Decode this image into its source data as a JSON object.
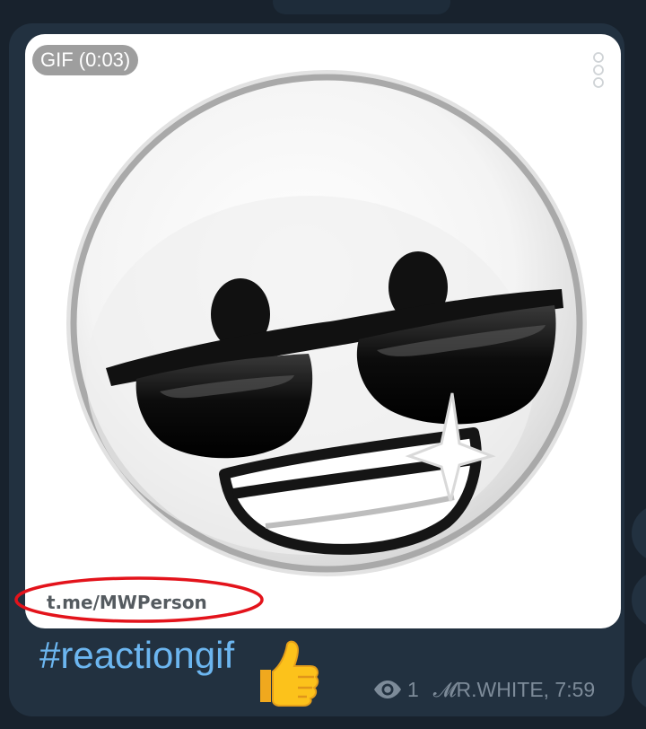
{
  "message": {
    "media": {
      "type_label": "GIF (0:03)",
      "watermark": "t.me/MWPerson",
      "annotation_color": "#e3131b"
    },
    "caption": "#reactiongif",
    "reaction_emoji": "thumbs-up",
    "views": "1",
    "signature": "𝓜R.WHITE, 7:59"
  },
  "colors": {
    "background": "#18222d",
    "bubble": "#223140",
    "link": "#6cb6f0",
    "meta": "#7d8b99"
  }
}
